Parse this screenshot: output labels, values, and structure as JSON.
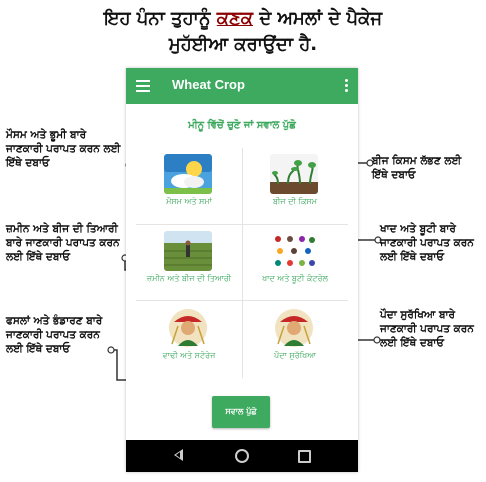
{
  "heading": {
    "line1_before": "ਇਹ ਪੰਨਾ ਤੁਹਾਨੂੰ",
    "line1_keyword": "ਕਣਕ",
    "line1_after": "ਦੇ ਅਮਲਾਂ ਦੇ ਪੈਕੇਜ",
    "line2": "ਮੁਹੱਈਆ ਕਰਾਉਂਦਾ ਹੈ."
  },
  "app": {
    "title": "Wheat Crop",
    "prompt": "ਮੀਨੂ ਵਿੱਚੋਂ ਚੁਣੋ ਜਾਂ ਸਵਾਲ ਪੁੱਛੋ",
    "ask_button": "ਸਵਾਲ ਪੁੱਛੋ"
  },
  "menu": [
    {
      "label": "ਮੌਸਮ ਅਤੇ ਸਮਾਂ",
      "icon": "weather-icon"
    },
    {
      "label": "ਬੀਜ ਦੀ ਕਿਸਮ",
      "icon": "seedling-icon"
    },
    {
      "label": "ਜ਼ਮੀਨ ਅਤੇ ਬੀਜ ਦੀ ਤਿਆਰੀ",
      "icon": "field-icon"
    },
    {
      "label": "ਖਾਦ ਅਤੇ ਬੂਟੀ ਕੰਟਰੋਲ",
      "icon": "pests-icon"
    },
    {
      "label": "ਵਾਢੀ ਅਤੇ ਸਟੋਰੇਜ",
      "icon": "farmer-icon"
    },
    {
      "label": "ਪੌਦਾ ਸੁਰੱਖਿਆ",
      "icon": "farmer-icon"
    }
  ],
  "callouts": {
    "weather": "ਮੌਸਮ ਅਤੇ ਭੂਮੀ ਬਾਰੇ ਜਾਣਕਾਰੀ ਪਰਾਪਤ ਕਰਨ ਲਈ ਇੱਥੇ ਦਬਾਓ",
    "seed": "ਬੀਜ ਕਿਸਮ ਲੱਭਣ ਲਈ ਇੱਥੇ ਦਬਾਓ",
    "land": "ਜ਼ਮੀਨ ਅਤੇ ਬੀਜ ਦੀ ਤਿਆਰੀ ਬਾਰੇ ਜਾਣਕਾਰੀ ਪਰਾਪਤ ਕਰਨ ਲਈ ਇੱਥੇ ਦਬਾਓ",
    "fertilizer": "ਖਾਦ ਅਤੇ ਬੂਟੀ ਬਾਰੇ ਜਾਣਕਾਰੀ ਪਰਾਪਤ ਕਰਨ ਲਈ ਇੱਥੇ ਦਬਾਓ",
    "harvest": "ਫਸਲਾਂ ਅਤੇ ਭੰਡਾਰਣ ਬਾਰੇ ਜਾਣਕਾਰੀ ਪਰਾਪਤ ਕਰਨ ਲਈ ਇੱਥੇ ਦਬਾਓ",
    "protection": "ਪੌਦਾ ਸੁਰੱਖਿਆ ਬਾਰੇ ਜਾਣਕਾਰੀ ਪਰਾਪਤ ਕਰਨ ਲਈ ਇੱਥੇ ਦਬਾਓ"
  },
  "colors": {
    "accent": "#3daa5f",
    "navbar": "#000000"
  }
}
